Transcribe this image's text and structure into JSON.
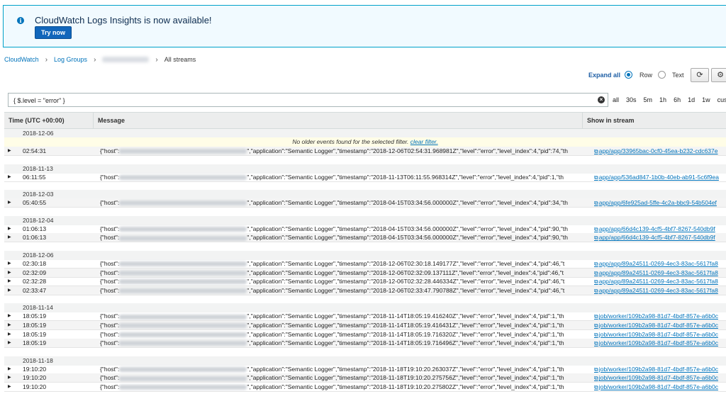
{
  "banner": {
    "message": "CloudWatch Logs Insights is now available!",
    "button": "Try now",
    "icon": "info-icon"
  },
  "breadcrumb": {
    "items": [
      "CloudWatch",
      "Log Groups"
    ],
    "current": "All streams"
  },
  "controls": {
    "expand_all": "Expand all",
    "row_label": "Row",
    "text_label": "Text",
    "selected_view": "Row"
  },
  "filter": {
    "value": "{ $.level = \"error\" }"
  },
  "time_ranges": [
    "all",
    "30s",
    "5m",
    "1h",
    "6h",
    "1d",
    "1w",
    "custo"
  ],
  "table": {
    "headers": [
      "Time (UTC +00:00)",
      "Message",
      "Show in stream"
    ],
    "notice_text": "No older events found for the selected filter.",
    "notice_link": "clear filter."
  },
  "rows": [
    {
      "kind": "date",
      "date": "2018-12-06"
    },
    {
      "kind": "notice"
    },
    {
      "kind": "log",
      "time": "02:54:31",
      "pre": "{\"host\":",
      "post": "\",\"application\":\"Semantic Logger\",\"timestamp\":\"2018-12-06T02:54:31.968981Z\",\"level\":\"error\",\"level_index\":4,\"pid\":74,\"th",
      "stream": "app/app/33965bac-0cf0-45ea-b232-cdc637e"
    },
    {
      "kind": "gap"
    },
    {
      "kind": "date",
      "date": "2018-11-13"
    },
    {
      "kind": "log",
      "time": "06:11:55",
      "pre": "{\"host\":",
      "post": "\",\"application\":\"Semantic Logger\",\"timestamp\":\"2018-11-13T06:11:55.968314Z\",\"level\":\"error\",\"level_index\":4,\"pid\":1,\"th",
      "stream": "app/app/536ad847-1b0b-40eb-ab91-5c6f9ea"
    },
    {
      "kind": "gap"
    },
    {
      "kind": "date",
      "date": "2018-12-03"
    },
    {
      "kind": "log",
      "time": "05:40:55",
      "pre": "{\"host\":",
      "post": "\",\"application\":\"Semantic Logger\",\"timestamp\":\"2018-04-15T03:34:56.000000Z\",\"level\":\"error\",\"level_index\":4,\"pid\":34,\"th",
      "stream": "app/app/6fe925ad-5ffe-4c2a-bbc9-54b504ef"
    },
    {
      "kind": "gap"
    },
    {
      "kind": "date",
      "date": "2018-12-04"
    },
    {
      "kind": "log",
      "time": "01:06:13",
      "pre": "{\"host\":",
      "post": "\",\"application\":\"Semantic Logger\",\"timestamp\":\"2018-04-15T03:34:56.000000Z\",\"level\":\"error\",\"level_index\":4,\"pid\":90,\"th",
      "stream": "app/app/66d4c139-4cf5-4bf7-8267-540db9f"
    },
    {
      "kind": "log",
      "time": "01:06:13",
      "pre": "{\"host\":",
      "post": "\",\"application\":\"Semantic Logger\",\"timestamp\":\"2018-04-15T03:34:56.000000Z\",\"level\":\"error\",\"level_index\":4,\"pid\":90,\"th",
      "stream": "app/app/66d4c139-4cf5-4bf7-8267-540db9f"
    },
    {
      "kind": "gap"
    },
    {
      "kind": "date",
      "date": "2018-12-06"
    },
    {
      "kind": "log",
      "time": "02:30:18",
      "pre": "{\"host\":",
      "post": "\",\"application\":\"Semantic Logger\",\"timestamp\":\"2018-12-06T02:30:18.149177Z\",\"level\":\"error\",\"level_index\":4,\"pid\":46,\"t",
      "stream": "app/app/89a24511-0269-4ec3-83ac-5617fa8"
    },
    {
      "kind": "log",
      "time": "02:32:09",
      "pre": "{\"host\":",
      "post": "\",\"application\":\"Semantic Logger\",\"timestamp\":\"2018-12-06T02:32:09.137111Z\",\"level\":\"error\",\"level_index\":4,\"pid\":46,\"t",
      "stream": "app/app/89a24511-0269-4ec3-83ac-5617fa8"
    },
    {
      "kind": "log",
      "time": "02:32:28",
      "pre": "{\"host\":",
      "post": "\",\"application\":\"Semantic Logger\",\"timestamp\":\"2018-12-06T02:32:28.446334Z\",\"level\":\"error\",\"level_index\":4,\"pid\":46,\"t",
      "stream": "app/app/89a24511-0269-4ec3-83ac-5617fa8"
    },
    {
      "kind": "log",
      "time": "02:33:47",
      "pre": "{\"host\":",
      "post": "\",\"application\":\"Semantic Logger\",\"timestamp\":\"2018-12-06T02:33:47.790788Z\",\"level\":\"error\",\"level_index\":4,\"pid\":46,\"t",
      "stream": "app/app/89a24511-0269-4ec3-83ac-5617fa8"
    },
    {
      "kind": "gap"
    },
    {
      "kind": "date",
      "date": "2018-11-14"
    },
    {
      "kind": "log",
      "time": "18:05:19",
      "pre": "{\"host\":",
      "post": "\",\"application\":\"Semantic Logger\",\"timestamp\":\"2018-11-14T18:05:19.416240Z\",\"level\":\"error\",\"level_index\":4,\"pid\":1,\"th",
      "stream": "job/worker/109b2a98-81d7-4bdf-857e-a6b0c"
    },
    {
      "kind": "log",
      "time": "18:05:19",
      "pre": "{\"host\":",
      "post": "\",\"application\":\"Semantic Logger\",\"timestamp\":\"2018-11-14T18:05:19.416431Z\",\"level\":\"error\",\"level_index\":4,\"pid\":1,\"th",
      "stream": "job/worker/109b2a98-81d7-4bdf-857e-a6b0c"
    },
    {
      "kind": "log",
      "time": "18:05:19",
      "pre": "{\"host\":",
      "post": "\",\"application\":\"Semantic Logger\",\"timestamp\":\"2018-11-14T18:05:19.716320Z\",\"level\":\"error\",\"level_index\":4,\"pid\":1,\"th",
      "stream": "job/worker/109b2a98-81d7-4bdf-857e-a6b0c"
    },
    {
      "kind": "log",
      "time": "18:05:19",
      "pre": "{\"host\":",
      "post": "\",\"application\":\"Semantic Logger\",\"timestamp\":\"2018-11-14T18:05:19.716496Z\",\"level\":\"error\",\"level_index\":4,\"pid\":1,\"th",
      "stream": "job/worker/109b2a98-81d7-4bdf-857e-a6b0c"
    },
    {
      "kind": "gap"
    },
    {
      "kind": "date",
      "date": "2018-11-18"
    },
    {
      "kind": "log",
      "time": "19:10:20",
      "pre": "{\"host\":",
      "post": "\",\"application\":\"Semantic Logger\",\"timestamp\":\"2018-11-18T19:10:20.263037Z\",\"level\":\"error\",\"level_index\":4,\"pid\":1,\"th",
      "stream": "job/worker/109b2a98-81d7-4bdf-857e-a6b0c"
    },
    {
      "kind": "log",
      "time": "19:10:20",
      "pre": "{\"host\":",
      "post": "\",\"application\":\"Semantic Logger\",\"timestamp\":\"2018-11-18T19:10:20.275756Z\",\"level\":\"error\",\"level_index\":4,\"pid\":1,\"th",
      "stream": "job/worker/109b2a98-81d7-4bdf-857e-a6b0c"
    },
    {
      "kind": "log",
      "time": "19:10:20",
      "pre": "{\"host\":",
      "post": "\",\"application\":\"Semantic Logger\",\"timestamp\":\"2018-11-18T19:10:20.275802Z\",\"level\":\"error\",\"level_index\":4,\"pid\":1,\"th",
      "stream": "job/worker/109b2a98-81d7-4bdf-857e-a6b0c"
    }
  ]
}
